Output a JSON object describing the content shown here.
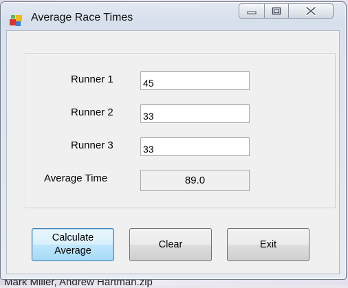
{
  "window": {
    "title": "Average Race Times"
  },
  "background": {
    "footer_text": "Mark Miller, Andrew Hartman.zip"
  },
  "form": {
    "runners": [
      {
        "label": "Runner 1",
        "value": "45"
      },
      {
        "label": "Runner 2",
        "value": "33"
      },
      {
        "label": "Runner 3",
        "value": "33"
      }
    ],
    "average_label": "Average Time",
    "average_value": "89.0"
  },
  "buttons": {
    "calculate_label": "Calculate\nAverage",
    "clear_label": "Clear",
    "exit_label": "Exit"
  },
  "icons": {
    "app": "app-icon",
    "minimize": "minimize-icon",
    "maximize": "maximize-icon",
    "close": "close-icon"
  },
  "colors": {
    "default_button_border": "#3c7fb1",
    "default_button_fill": "#bee6fd"
  }
}
